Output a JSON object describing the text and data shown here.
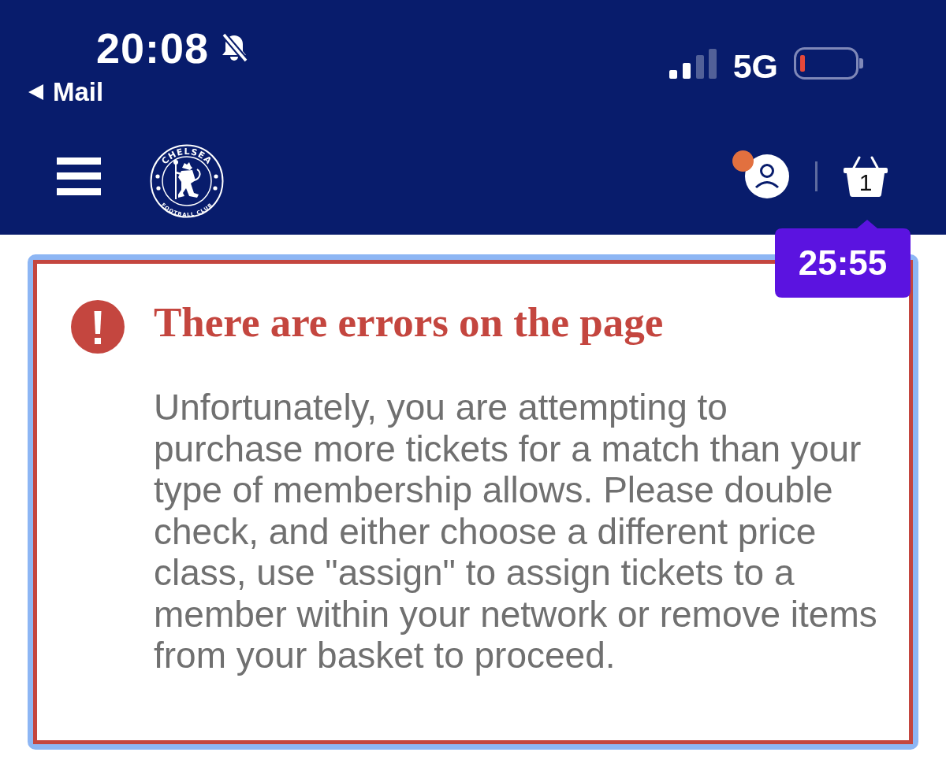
{
  "status_bar": {
    "time": "20:08",
    "silent": true,
    "back_link": "Mail",
    "network": "5G"
  },
  "header": {
    "crest": {
      "top_text": "CHELSEA",
      "bottom_text": "FOOTBALL CLUB"
    },
    "notification": true,
    "basket_count": "1",
    "timer": "25:55"
  },
  "alert": {
    "kind": "error",
    "title": "There are errors on the page",
    "message": "Unfortunately, you are attempting to purchase more tickets for a match than your type of membership allows. Please double check, and either choose a different price class, use \"assign\" to assign tickets to a member within your network or remove items from your basket to proceed."
  }
}
